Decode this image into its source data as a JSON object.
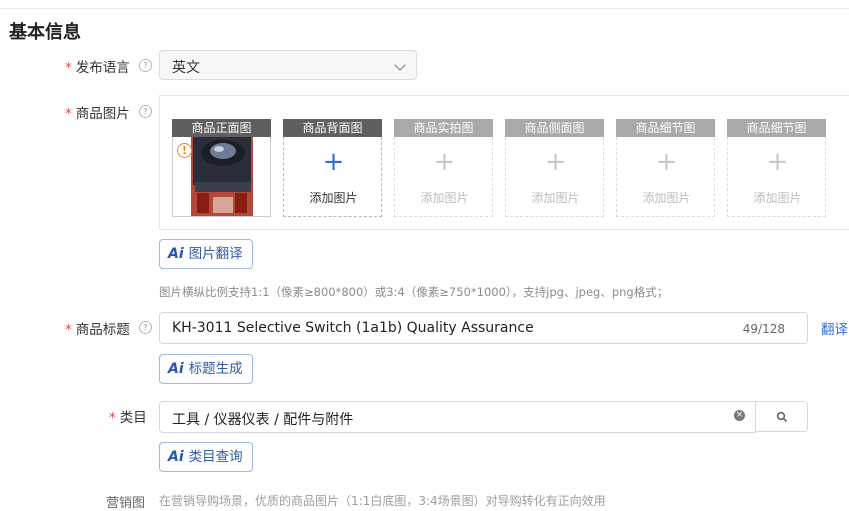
{
  "section": {
    "title": "基本信息"
  },
  "fields": {
    "language": {
      "label": "发布语言",
      "value": "英文"
    },
    "images": {
      "label": "商品图片",
      "slots": [
        {
          "title": "商品正面图",
          "filled": true,
          "add_text": ""
        },
        {
          "title": "商品背面图",
          "filled": false,
          "add_text": "添加图片",
          "active": true
        },
        {
          "title": "商品实拍图",
          "filled": false,
          "add_text": "添加图片",
          "active": false
        },
        {
          "title": "商品侧面图",
          "filled": false,
          "add_text": "添加图片",
          "active": false
        },
        {
          "title": "商品细节图",
          "filled": false,
          "add_text": "添加图片",
          "active": false
        },
        {
          "title": "商品细节图",
          "filled": false,
          "add_text": "添加图片",
          "active": false
        }
      ],
      "ai_button": "图片翻译",
      "hint": "图片横纵比例支持1:1（像素≥800*800）或3:4（像素≥750*1000），支持jpg、jpeg、png格式；"
    },
    "title": {
      "label": "商品标题",
      "value": "KH-3011 Selective Switch (1a1b) Quality Assurance",
      "counter": "49/128",
      "translate_link": "翻译",
      "ai_button": "标题生成"
    },
    "category": {
      "label": "类目",
      "value": "工具 / 仪器仪表 / 配件与附件",
      "ai_button": "类目查询"
    },
    "marketing": {
      "label": "营销图",
      "hint": "在营销导购场景，优质的商品图片（1:1白底图，3:4场景图）对导购转化有正向效用"
    }
  },
  "colors": {
    "required": "#e54545",
    "accent": "#2f6fd6",
    "slot_header_active": "#5f5f5f",
    "slot_header_inactive": "#a9a9a9"
  }
}
